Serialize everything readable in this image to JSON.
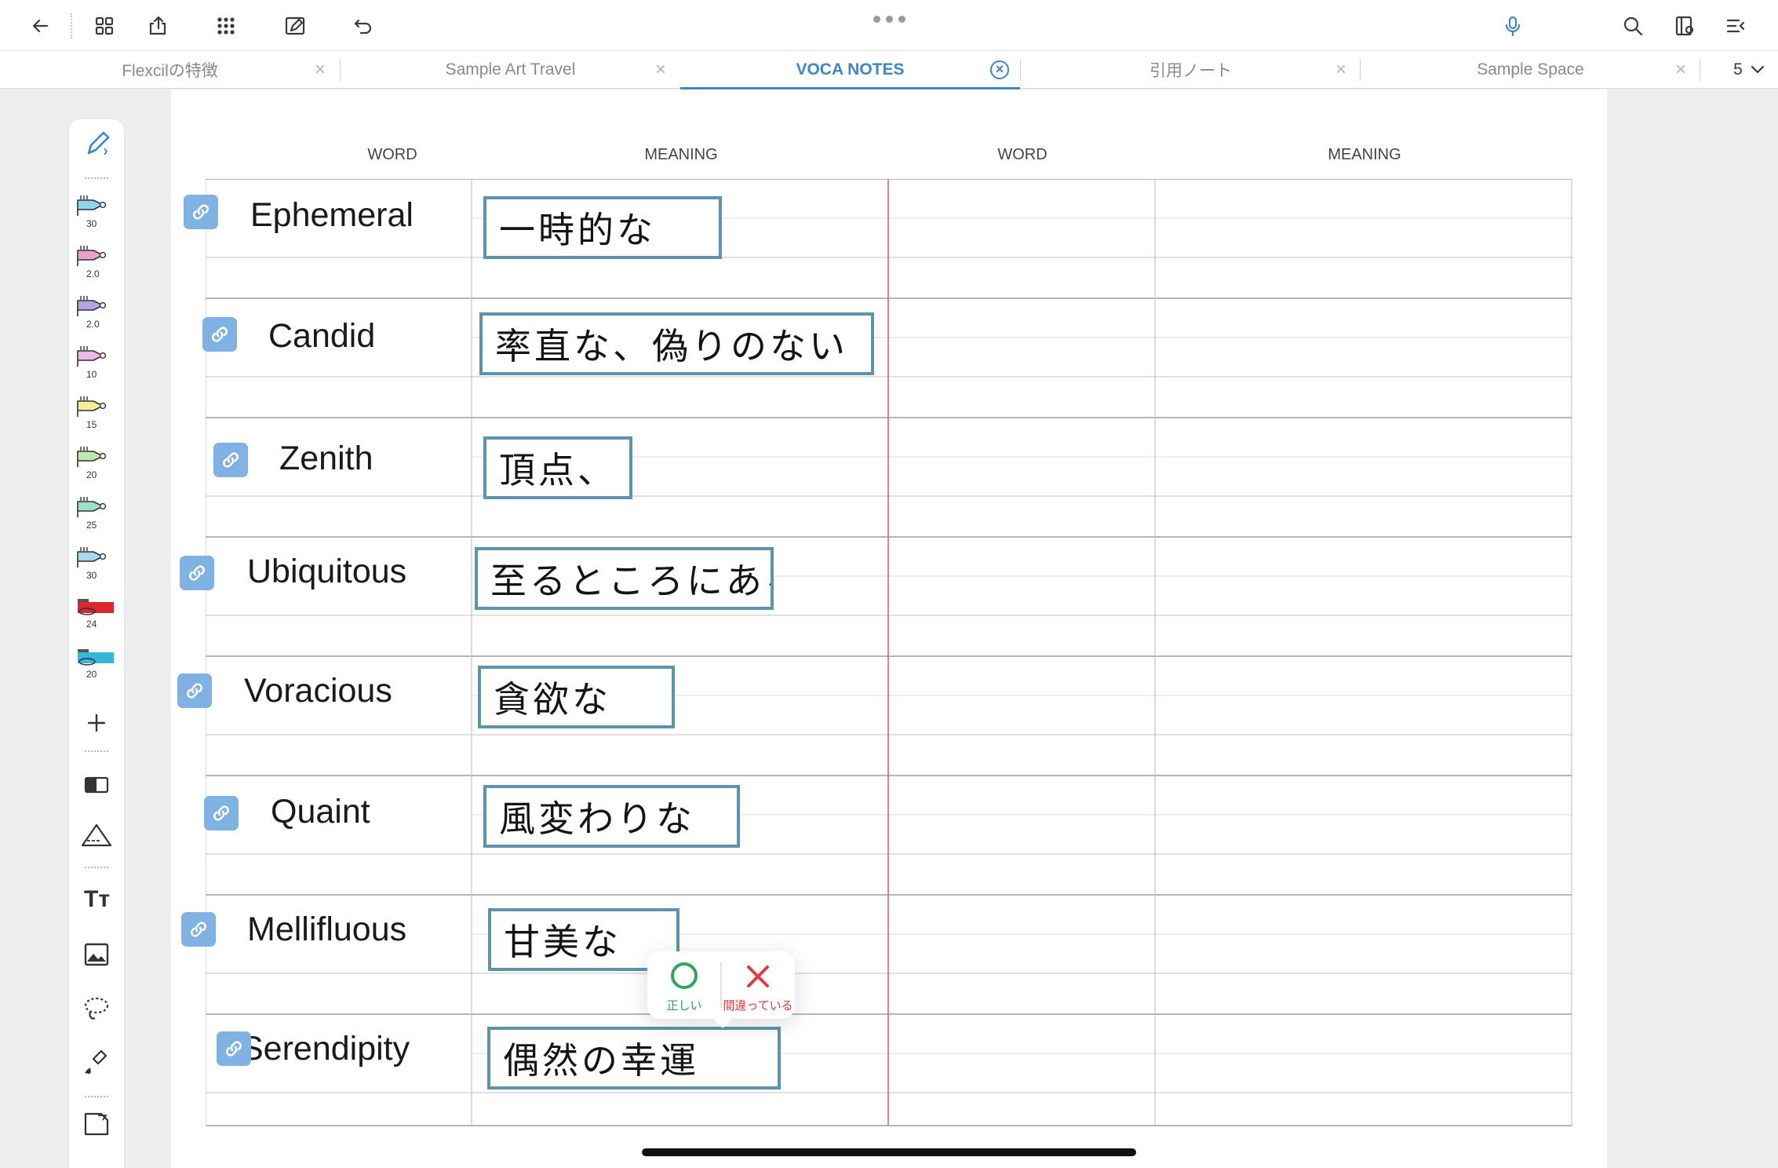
{
  "toolbar": {
    "icons": [
      "back-arrow-icon",
      "grid-view-icon",
      "export-icon",
      "apps-icon",
      "edit-page-icon",
      "undo-icon",
      "more-icon",
      "microphone-icon",
      "search-icon",
      "page-settings-icon",
      "menu-icon"
    ],
    "accent": "#3f86c4"
  },
  "tabs": [
    {
      "label": "Flexcilの特徴",
      "active": false
    },
    {
      "label": "Sample Art Travel",
      "active": false
    },
    {
      "label": "VOCA NOTES",
      "active": true
    },
    {
      "label": "引用ノート",
      "active": false
    },
    {
      "label": "Sample Space",
      "active": false
    }
  ],
  "tab_count": "5",
  "palette": {
    "tools": [
      {
        "name": "pen-icon"
      },
      {
        "name": "highlighter-blue",
        "size": "30",
        "color": "#8fd3ee"
      },
      {
        "name": "pen-pink",
        "size": "2.0",
        "color": "#e8a4c8"
      },
      {
        "name": "pen-purple",
        "size": "2.0",
        "color": "#b7a2e6"
      },
      {
        "name": "highlighter-pink",
        "size": "10",
        "color": "#f0b8e8"
      },
      {
        "name": "highlighter-yellow",
        "size": "15",
        "color": "#f6ec9a"
      },
      {
        "name": "highlighter-green",
        "size": "20",
        "color": "#bfe7b0"
      },
      {
        "name": "highlighter-mint",
        "size": "25",
        "color": "#9fe0c6"
      },
      {
        "name": "highlighter-cyan",
        "size": "30",
        "color": "#a8d8ee"
      },
      {
        "name": "tape-red",
        "size": "24",
        "color": "#d9272e"
      },
      {
        "name": "tape-cyan",
        "size": "20",
        "color": "#36b6d9"
      }
    ]
  },
  "table": {
    "headers": [
      "WORD",
      "MEANING",
      "WORD",
      "MEANING"
    ],
    "rows": [
      {
        "word": "Ephemeral",
        "meaning": "一時的な"
      },
      {
        "word": "Candid",
        "meaning": "率直な、偽りのない"
      },
      {
        "word": "Zenith",
        "meaning": "頂点、"
      },
      {
        "word": "Ubiquitous",
        "meaning": "至るところにある"
      },
      {
        "word": "Voracious",
        "meaning": "貪欲な"
      },
      {
        "word": "Quaint",
        "meaning": "風変わりな"
      },
      {
        "word": "Mellifluous",
        "meaning": "甘美な"
      },
      {
        "word": "Serendipity",
        "meaning": "偶然の幸運"
      }
    ]
  },
  "judge_popup": {
    "correct_label": "正しい",
    "wrong_label": "間違っている",
    "correct_color": "#2fa65a",
    "wrong_color": "#e23b3b"
  }
}
